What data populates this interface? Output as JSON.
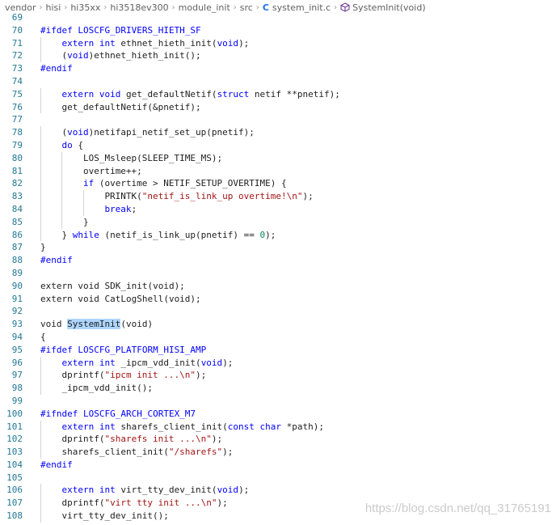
{
  "breadcrumb": {
    "items": [
      "vendor",
      "hisi",
      "hi35xx",
      "hi3518ev300",
      "module_init",
      "src"
    ],
    "file_icon": "C",
    "file_name": "system_init.c",
    "symbol_icon": "cube-icon",
    "symbol_name": "SystemInit(void)"
  },
  "colors": {
    "keyword": "#0000ff",
    "string": "#a31515",
    "preprocessor": "#0000ff",
    "number": "#098658",
    "plain": "#1e1e1e",
    "line_number": "#237893",
    "selection": "#add6ff"
  },
  "lines": [
    {
      "n": "69",
      "indent": 0,
      "tokens": []
    },
    {
      "n": "70",
      "indent": 0,
      "tokens": [
        [
          "pp",
          "#ifdef LOSCFG_DRIVERS_HIETH_SF"
        ]
      ]
    },
    {
      "n": "71",
      "indent": 1,
      "tokens": [
        [
          "kw",
          "extern"
        ],
        [
          "p",
          " "
        ],
        [
          "kw",
          "int"
        ],
        [
          "p",
          " ethnet_hieth_init("
        ],
        [
          "kw",
          "void"
        ],
        [
          "p",
          ");"
        ]
      ]
    },
    {
      "n": "72",
      "indent": 1,
      "tokens": [
        [
          "p",
          "("
        ],
        [
          "kw",
          "void"
        ],
        [
          "p",
          ")ethnet_hieth_init();"
        ]
      ]
    },
    {
      "n": "73",
      "indent": 0,
      "tokens": [
        [
          "pp",
          "#endif"
        ]
      ]
    },
    {
      "n": "74",
      "indent": 0,
      "tokens": []
    },
    {
      "n": "75",
      "indent": 1,
      "tokens": [
        [
          "kw",
          "extern"
        ],
        [
          "p",
          " "
        ],
        [
          "kw",
          "void"
        ],
        [
          "p",
          " get_defaultNetif("
        ],
        [
          "kw",
          "struct"
        ],
        [
          "p",
          " netif **pnetif);"
        ]
      ]
    },
    {
      "n": "76",
      "indent": 1,
      "tokens": [
        [
          "p",
          "get_defaultNetif(&pnetif);"
        ]
      ]
    },
    {
      "n": "77",
      "indent": 0,
      "tokens": []
    },
    {
      "n": "78",
      "indent": 1,
      "tokens": [
        [
          "p",
          "("
        ],
        [
          "kw",
          "void"
        ],
        [
          "p",
          ")netifapi_netif_set_up(pnetif);"
        ]
      ]
    },
    {
      "n": "79",
      "indent": 1,
      "tokens": [
        [
          "kw",
          "do"
        ],
        [
          "p",
          " {"
        ]
      ]
    },
    {
      "n": "80",
      "indent": 2,
      "tokens": [
        [
          "p",
          "LOS_Msleep(SLEEP_TIME_MS);"
        ]
      ]
    },
    {
      "n": "81",
      "indent": 2,
      "tokens": [
        [
          "p",
          "overtime++;"
        ]
      ]
    },
    {
      "n": "82",
      "indent": 2,
      "tokens": [
        [
          "kw",
          "if"
        ],
        [
          "p",
          " (overtime > NETIF_SETUP_OVERTIME) {"
        ]
      ]
    },
    {
      "n": "83",
      "indent": 3,
      "tokens": [
        [
          "p",
          "PRINTK("
        ],
        [
          "str",
          "\"netif_is_link_up overtime!\\n\""
        ],
        [
          "p",
          ");"
        ]
      ]
    },
    {
      "n": "84",
      "indent": 3,
      "tokens": [
        [
          "kw",
          "break"
        ],
        [
          "p",
          ";"
        ]
      ]
    },
    {
      "n": "85",
      "indent": 2,
      "tokens": [
        [
          "p",
          "}"
        ]
      ]
    },
    {
      "n": "86",
      "indent": 1,
      "tokens": [
        [
          "p",
          "} "
        ],
        [
          "kw",
          "while"
        ],
        [
          "p",
          " (netif_is_link_up(pnetif) == "
        ],
        [
          "num",
          "0"
        ],
        [
          "p",
          ");"
        ]
      ]
    },
    {
      "n": "87",
      "indent": 0,
      "tokens": [
        [
          "p",
          "}"
        ]
      ]
    },
    {
      "n": "88",
      "indent": 0,
      "tokens": [
        [
          "pp",
          "#endif"
        ]
      ]
    },
    {
      "n": "89",
      "indent": 0,
      "tokens": []
    },
    {
      "n": "90",
      "indent": 0,
      "tokens": [
        [
          "p",
          "extern void SDK_init(void);"
        ]
      ]
    },
    {
      "n": "91",
      "indent": 0,
      "tokens": [
        [
          "p",
          "extern void CatLogShell(void);"
        ]
      ]
    },
    {
      "n": "92",
      "indent": 0,
      "tokens": []
    },
    {
      "n": "93",
      "indent": 0,
      "tokens": [
        [
          "p",
          "void "
        ],
        [
          "hl",
          "SystemInit"
        ],
        [
          "p",
          "(void)"
        ]
      ]
    },
    {
      "n": "94",
      "indent": 0,
      "tokens": [
        [
          "p",
          "{"
        ]
      ]
    },
    {
      "n": "95",
      "indent": 0,
      "tokens": [
        [
          "pp",
          "#ifdef LOSCFG_PLATFORM_HISI_AMP"
        ]
      ]
    },
    {
      "n": "96",
      "indent": 1,
      "tokens": [
        [
          "kw",
          "extern"
        ],
        [
          "p",
          " "
        ],
        [
          "kw",
          "int"
        ],
        [
          "p",
          " _ipcm_vdd_init("
        ],
        [
          "kw",
          "void"
        ],
        [
          "p",
          ");"
        ]
      ]
    },
    {
      "n": "97",
      "indent": 1,
      "tokens": [
        [
          "p",
          "dprintf("
        ],
        [
          "str",
          "\"ipcm init ...\\n\""
        ],
        [
          "p",
          ");"
        ]
      ]
    },
    {
      "n": "98",
      "indent": 1,
      "tokens": [
        [
          "p",
          "_ipcm_vdd_init();"
        ]
      ]
    },
    {
      "n": "99",
      "indent": 0,
      "tokens": []
    },
    {
      "n": "100",
      "indent": 0,
      "tokens": [
        [
          "pp",
          "#ifndef LOSCFG_ARCH_CORTEX_M7"
        ]
      ]
    },
    {
      "n": "101",
      "indent": 1,
      "tokens": [
        [
          "kw",
          "extern"
        ],
        [
          "p",
          " "
        ],
        [
          "kw",
          "int"
        ],
        [
          "p",
          " sharefs_client_init("
        ],
        [
          "kw",
          "const"
        ],
        [
          "p",
          " "
        ],
        [
          "kw",
          "char"
        ],
        [
          "p",
          " *path);"
        ]
      ]
    },
    {
      "n": "102",
      "indent": 1,
      "tokens": [
        [
          "p",
          "dprintf("
        ],
        [
          "str",
          "\"sharefs init ...\\n\""
        ],
        [
          "p",
          ");"
        ]
      ]
    },
    {
      "n": "103",
      "indent": 1,
      "tokens": [
        [
          "p",
          "sharefs_client_init("
        ],
        [
          "str",
          "\"/sharefs\""
        ],
        [
          "p",
          ");"
        ]
      ]
    },
    {
      "n": "104",
      "indent": 0,
      "tokens": [
        [
          "pp",
          "#endif"
        ]
      ]
    },
    {
      "n": "105",
      "indent": 0,
      "tokens": []
    },
    {
      "n": "106",
      "indent": 1,
      "tokens": [
        [
          "kw",
          "extern"
        ],
        [
          "p",
          " "
        ],
        [
          "kw",
          "int"
        ],
        [
          "p",
          " virt_tty_dev_init("
        ],
        [
          "kw",
          "void"
        ],
        [
          "p",
          ");"
        ]
      ]
    },
    {
      "n": "107",
      "indent": 1,
      "tokens": [
        [
          "p",
          "dprintf("
        ],
        [
          "str",
          "\"virt tty init ...\\n\""
        ],
        [
          "p",
          ");"
        ]
      ]
    },
    {
      "n": "108",
      "indent": 1,
      "tokens": [
        [
          "p",
          "virt_tty_dev_init();"
        ]
      ]
    }
  ],
  "watermark": "https://blog.csdn.net/qq_31765191"
}
